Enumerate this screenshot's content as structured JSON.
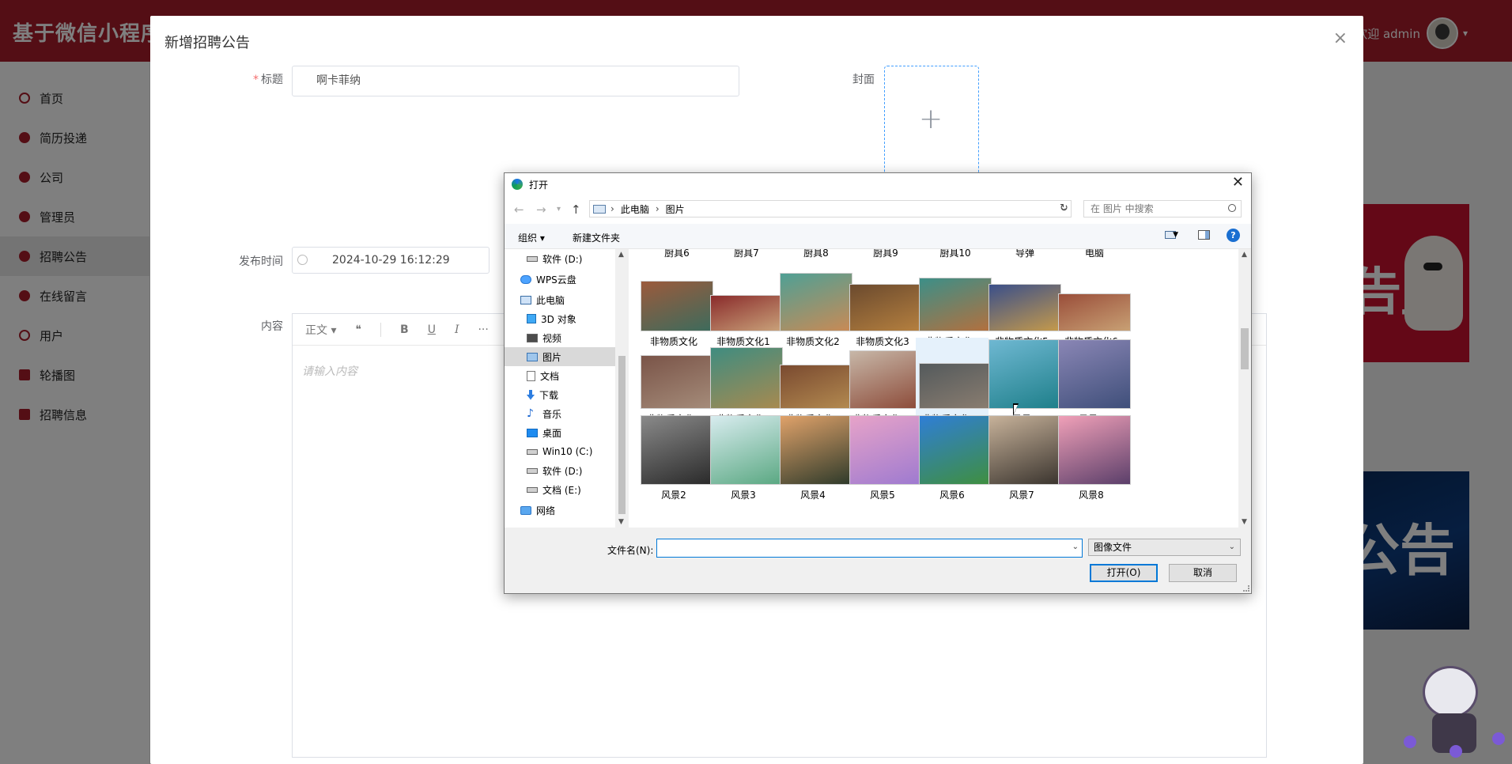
{
  "app": {
    "brand": "基于微信小程序",
    "user_greeting": "欢迎 admin",
    "menu": [
      {
        "label": "首页",
        "icon": "home-icon"
      },
      {
        "label": "简历投递",
        "icon": "resume-icon"
      },
      {
        "label": "公司",
        "icon": "company-icon"
      },
      {
        "label": "管理员",
        "icon": "admin-icon"
      },
      {
        "label": "招聘公告",
        "icon": "notice-icon",
        "active": true
      },
      {
        "label": "在线留言",
        "icon": "message-icon"
      },
      {
        "label": "用户",
        "icon": "user-icon"
      },
      {
        "label": "轮播图",
        "icon": "carousel-icon"
      },
      {
        "label": "招聘信息",
        "icon": "job-icon"
      }
    ],
    "promo_text_1": "告」",
    "promo_text_2": "公告"
  },
  "modal": {
    "title": "新增招聘公告",
    "close_glyph": "×",
    "title_label": "标题",
    "title_value": "啊卡菲纳",
    "cover_label": "封面",
    "upload_glyph": "+",
    "date_label": "发布时间",
    "date_value": "2024-10-29 16:12:29",
    "content_label": "内容",
    "toolbar": {
      "style": "正文",
      "quote": "❝",
      "bold": "B",
      "underline": "U",
      "italic": "I",
      "more": "···"
    },
    "content_placeholder": "请输入内容"
  },
  "dialog": {
    "title": "打开",
    "close_glyph": "✕",
    "path": [
      "此电脑",
      "图片"
    ],
    "search_placeholder": "在 图片 中搜索",
    "organize_label": "组织 ▾",
    "new_folder_label": "新建文件夹",
    "help_glyph": "?",
    "tree": [
      {
        "label": "软件 (D:)",
        "icon": "drive-icon",
        "indent": 28
      },
      {
        "label": "WPS云盘",
        "icon": "cloud-icon",
        "indent": 20,
        "gap": true
      },
      {
        "label": "此电脑",
        "icon": "computer-icon",
        "indent": 20,
        "gap": true
      },
      {
        "label": "3D 对象",
        "icon": "3d-objects-icon",
        "indent": 28
      },
      {
        "label": "视频",
        "icon": "video-icon",
        "indent": 28
      },
      {
        "label": "图片",
        "icon": "pictures-icon",
        "indent": 28,
        "selected": true
      },
      {
        "label": "文档",
        "icon": "documents-icon",
        "indent": 28
      },
      {
        "label": "下载",
        "icon": "download-icon",
        "indent": 28
      },
      {
        "label": "音乐",
        "icon": "music-icon",
        "indent": 28
      },
      {
        "label": "桌面",
        "icon": "desktop-icon",
        "indent": 28
      },
      {
        "label": "Win10 (C:)",
        "icon": "drive-icon",
        "indent": 28
      },
      {
        "label": "软件 (D:)",
        "icon": "drive-icon",
        "indent": 28
      },
      {
        "label": "文档 (E:)",
        "icon": "drive-icon",
        "indent": 28
      },
      {
        "label": "网络",
        "icon": "network-icon",
        "indent": 20,
        "gap": true
      }
    ],
    "partial_row": [
      "厨具6",
      "厨具7",
      "厨具8",
      "厨具9",
      "厨具10",
      "导弹",
      "电脑"
    ],
    "files": [
      {
        "name": "非物质文化",
        "c1": "#9b5a3c",
        "c2": "#3d6b5c",
        "h": 64
      },
      {
        "name": "非物质文化1",
        "c1": "#8a2b2b",
        "c2": "#c9a27a",
        "h": 46
      },
      {
        "name": "非物质文化2",
        "c1": "#4fa095",
        "c2": "#c98a55",
        "h": 74
      },
      {
        "name": "非物质文化3",
        "c1": "#6b4a2e",
        "c2": "#b5803f",
        "h": 60
      },
      {
        "name": "非物质文化4",
        "c1": "#3c8f88",
        "c2": "#b3703e",
        "h": 68
      },
      {
        "name": "非物质文化5",
        "c1": "#3a4f8a",
        "c2": "#c59a4b",
        "h": 60
      },
      {
        "name": "非物质文化6",
        "c1": "#9a4e3a",
        "c2": "#c8a074",
        "h": 48
      },
      {
        "name": "非物质文化7",
        "c1": "#7a5448",
        "c2": "#a58c7a",
        "h": 68
      },
      {
        "name": "非物质文化8",
        "c1": "#3f8c80",
        "c2": "#a88a4f",
        "h": 78
      },
      {
        "name": "非物质文化9",
        "c1": "#7a4a30",
        "c2": "#b38a50",
        "h": 56
      },
      {
        "name": "非物质文化10",
        "c1": "#c7b7a8",
        "c2": "#8c4a38",
        "h": 74
      },
      {
        "name": "非物质文化11",
        "c1": "#545a5c",
        "c2": "#8a7d70",
        "h": 58,
        "highlight": true
      },
      {
        "name": "风景",
        "c1": "#6fb8d2",
        "c2": "#1e7f8a",
        "h": 88
      },
      {
        "name": "风景1",
        "c1": "#8a86b5",
        "c2": "#3f4f7a",
        "h": 88
      },
      {
        "name": "风景2",
        "c1": "#8a8a8a",
        "c2": "#2a2a2a",
        "h": 88
      },
      {
        "name": "风景3",
        "c1": "#d8ecef",
        "c2": "#5aa882",
        "h": 88
      },
      {
        "name": "风景4",
        "c1": "#e0a26a",
        "c2": "#2e3a2a",
        "h": 88
      },
      {
        "name": "风景5",
        "c1": "#e7a3c8",
        "c2": "#9e7ad0",
        "h": 88
      },
      {
        "name": "风景6",
        "c1": "#2f7ed6",
        "c2": "#3f8f3f",
        "h": 88
      },
      {
        "name": "风景7",
        "c1": "#c7b29a",
        "c2": "#3a342e",
        "h": 88
      },
      {
        "name": "风景8",
        "c1": "#f0a0b8",
        "c2": "#5b3f6a",
        "h": 88
      }
    ],
    "filename_label": "文件名(N):",
    "filename_value": "",
    "filetype_value": "图像文件",
    "open_button": "打开(O)",
    "cancel_button": "取消"
  }
}
